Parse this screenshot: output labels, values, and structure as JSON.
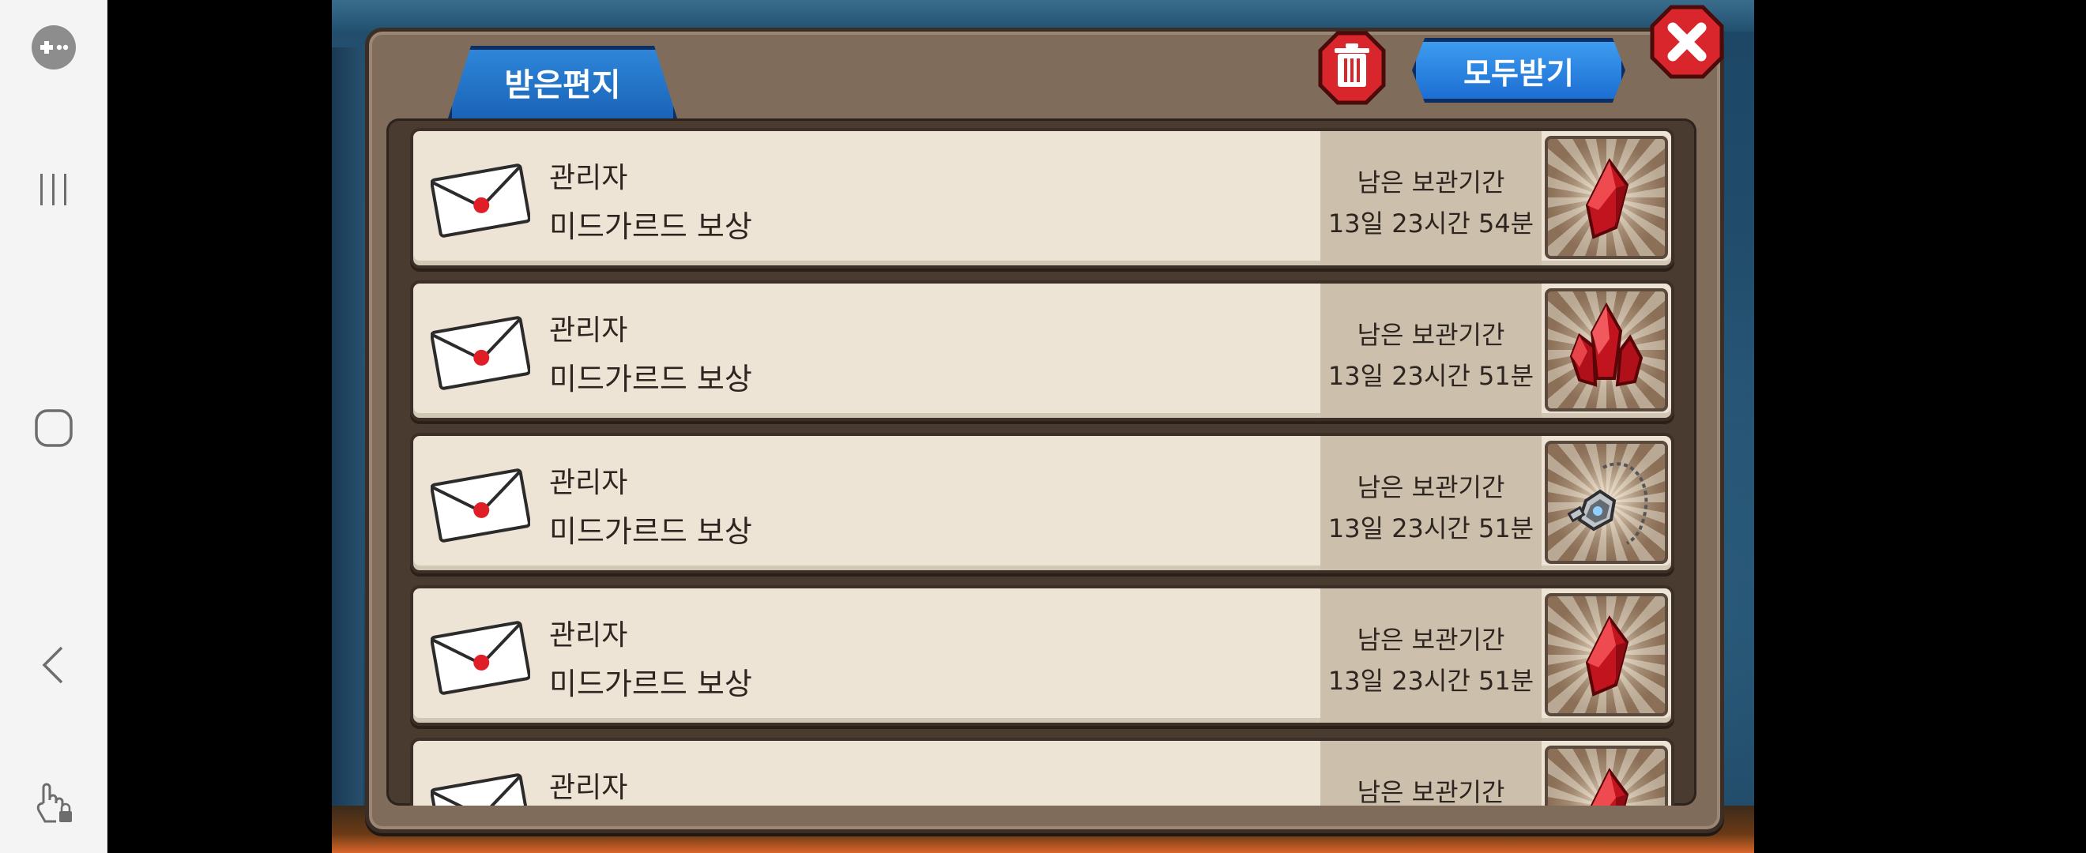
{
  "dialog": {
    "tab_label": "받은편지",
    "receive_all_label": "모두받기"
  },
  "mails": [
    {
      "sender": "관리자",
      "title": "미드가르드 보상",
      "remain_label": "남은 보관기간",
      "remain_time": "13일 23시간 54분",
      "item_icon": "red-gem-icon"
    },
    {
      "sender": "관리자",
      "title": "미드가르드 보상",
      "remain_label": "남은 보관기간",
      "remain_time": "13일 23시간 51분",
      "item_icon": "red-crystal-cluster-icon"
    },
    {
      "sender": "관리자",
      "title": "미드가르드 보상",
      "remain_label": "남은 보관기간",
      "remain_time": "13일 23시간 51분",
      "item_icon": "silver-pendant-icon"
    },
    {
      "sender": "관리자",
      "title": "미드가르드 보상",
      "remain_label": "남은 보관기간",
      "remain_time": "13일 23시간 51분",
      "item_icon": "red-gem-icon"
    },
    {
      "sender": "관리자",
      "title": "",
      "remain_label": "남은 보관기간",
      "remain_time": "",
      "item_icon": "red-gem-icon"
    }
  ],
  "colors": {
    "tab_blue": "#1a63b7",
    "dialog_brown": "#7f6c5a",
    "row_cream": "#ede4d5",
    "accent_red": "#d8262c"
  }
}
